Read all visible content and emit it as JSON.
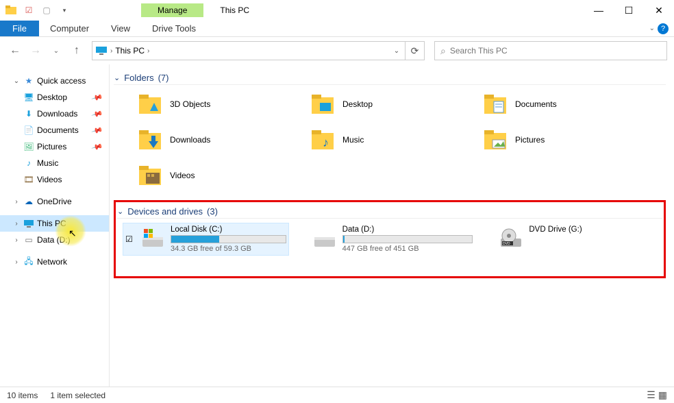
{
  "window": {
    "title_context_tab": "Manage",
    "title": "This PC",
    "ribbon": {
      "file": "File",
      "tabs": [
        "Computer",
        "View"
      ],
      "context_tab": "Drive Tools"
    }
  },
  "nav": {
    "breadcrumb": [
      "This PC"
    ],
    "search_placeholder": "Search This PC"
  },
  "sidebar": {
    "quick_access": {
      "label": "Quick access",
      "items": [
        {
          "label": "Desktop",
          "pinned": true
        },
        {
          "label": "Downloads",
          "pinned": true
        },
        {
          "label": "Documents",
          "pinned": true
        },
        {
          "label": "Pictures",
          "pinned": true
        },
        {
          "label": "Music",
          "pinned": false
        },
        {
          "label": "Videos",
          "pinned": false
        }
      ]
    },
    "onedrive": {
      "label": "OneDrive"
    },
    "this_pc": {
      "label": "This PC"
    },
    "data_d": {
      "label": "Data (D:)"
    },
    "network": {
      "label": "Network"
    }
  },
  "groups": {
    "folders": {
      "title": "Folders",
      "count": "(7)",
      "items": [
        {
          "label": "3D Objects"
        },
        {
          "label": "Desktop"
        },
        {
          "label": "Documents"
        },
        {
          "label": "Downloads"
        },
        {
          "label": "Music"
        },
        {
          "label": "Pictures"
        },
        {
          "label": "Videos"
        }
      ]
    },
    "drives": {
      "title": "Devices and drives",
      "count": "(3)",
      "items": [
        {
          "label": "Local Disk (C:)",
          "free_text": "34.3 GB free of 59.3 GB",
          "fill_pct": 42,
          "selected": true
        },
        {
          "label": "Data (D:)",
          "free_text": "447 GB free of 451 GB",
          "fill_pct": 1,
          "selected": false
        },
        {
          "label": "DVD Drive (G:)",
          "free_text": "",
          "fill_pct": null,
          "selected": false
        }
      ]
    }
  },
  "status": {
    "items": "10 items",
    "selected": "1 item selected"
  }
}
